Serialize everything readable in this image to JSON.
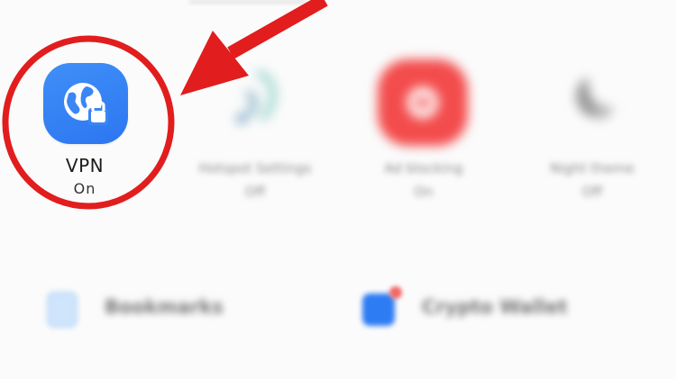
{
  "quick_tiles": {
    "vpn": {
      "label": "VPN",
      "state": "On",
      "icon": "globe-lock-icon"
    },
    "tile_2": {
      "label": "Hotspot Settings",
      "state": "Off",
      "icon": "wifi-signal-icon"
    },
    "tile_3": {
      "label": "Ad blocking",
      "state": "On",
      "icon": "shield-icon"
    },
    "tile_4": {
      "label": "Night theme",
      "state": "Off",
      "icon": "moon-icon"
    }
  },
  "list_items": {
    "bookmarks": {
      "label": "Bookmarks",
      "icon": "bookmark-icon"
    },
    "crypto_wallet": {
      "label": "Crypto Wallet",
      "icon": "wallet-icon"
    }
  },
  "colors": {
    "vpn_icon_bg": "#2c76f0",
    "annotation_red": "#e11d1d",
    "tile_3_bg": "#f34c4c"
  }
}
